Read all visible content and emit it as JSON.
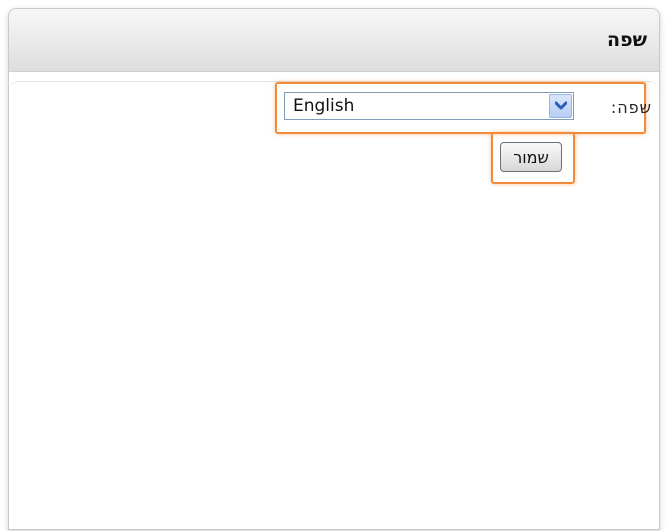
{
  "panel": {
    "title": "שפה"
  },
  "language_form": {
    "label": "שפה:",
    "selected_language": "English",
    "save_label": "שמור"
  },
  "colors": {
    "highlight": "#f08a3c",
    "dropdown_arrow": "#2d5bb8"
  },
  "icons": {
    "dropdown": "chevron-down-icon"
  }
}
